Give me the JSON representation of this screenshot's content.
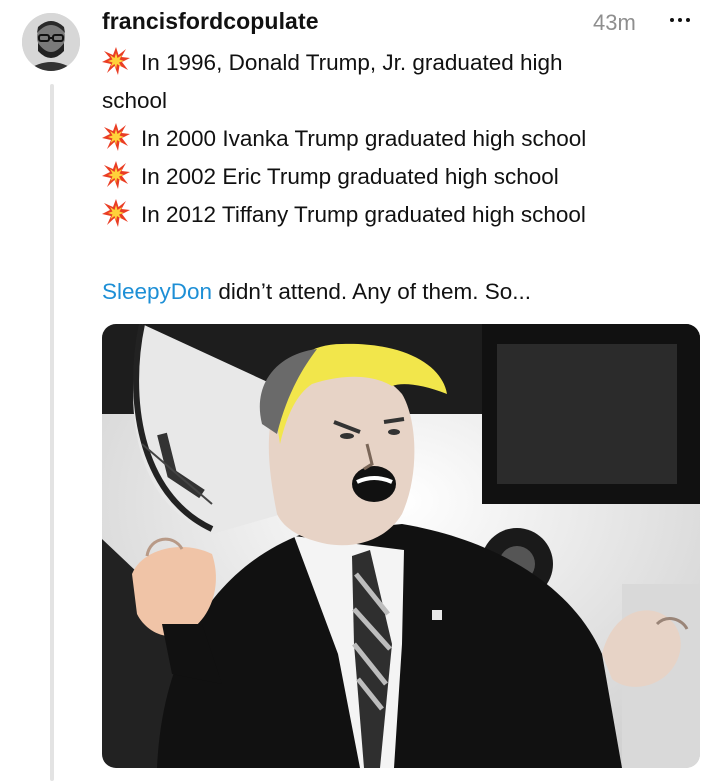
{
  "post": {
    "username": "francisfordcopulate",
    "timestamp": "43m",
    "more_icon": "ellipsis-icon",
    "lines": [
      {
        "text": "In 1996, Donald Trump, Jr. graduated high",
        "emoji": "collision-emoji"
      },
      {
        "text": "school"
      },
      {
        "text": "In 2000 Ivanka Trump graduated high school",
        "emoji": "collision-emoji"
      },
      {
        "text": "In 2002 Eric Trump graduated high school",
        "emoji": "collision-emoji"
      },
      {
        "text": "In 2012 Tiffany Trump graduated high school",
        "emoji": "collision-emoji"
      }
    ],
    "mention": "SleepyDon",
    "closing_text": " didn’t attend. Any of them. So..."
  },
  "colors": {
    "mention": "#1d8fd6",
    "timestamp": "#8e8e8e",
    "hair_highlight": "#f2e64b",
    "skin_tint": "#f0c4a7"
  }
}
